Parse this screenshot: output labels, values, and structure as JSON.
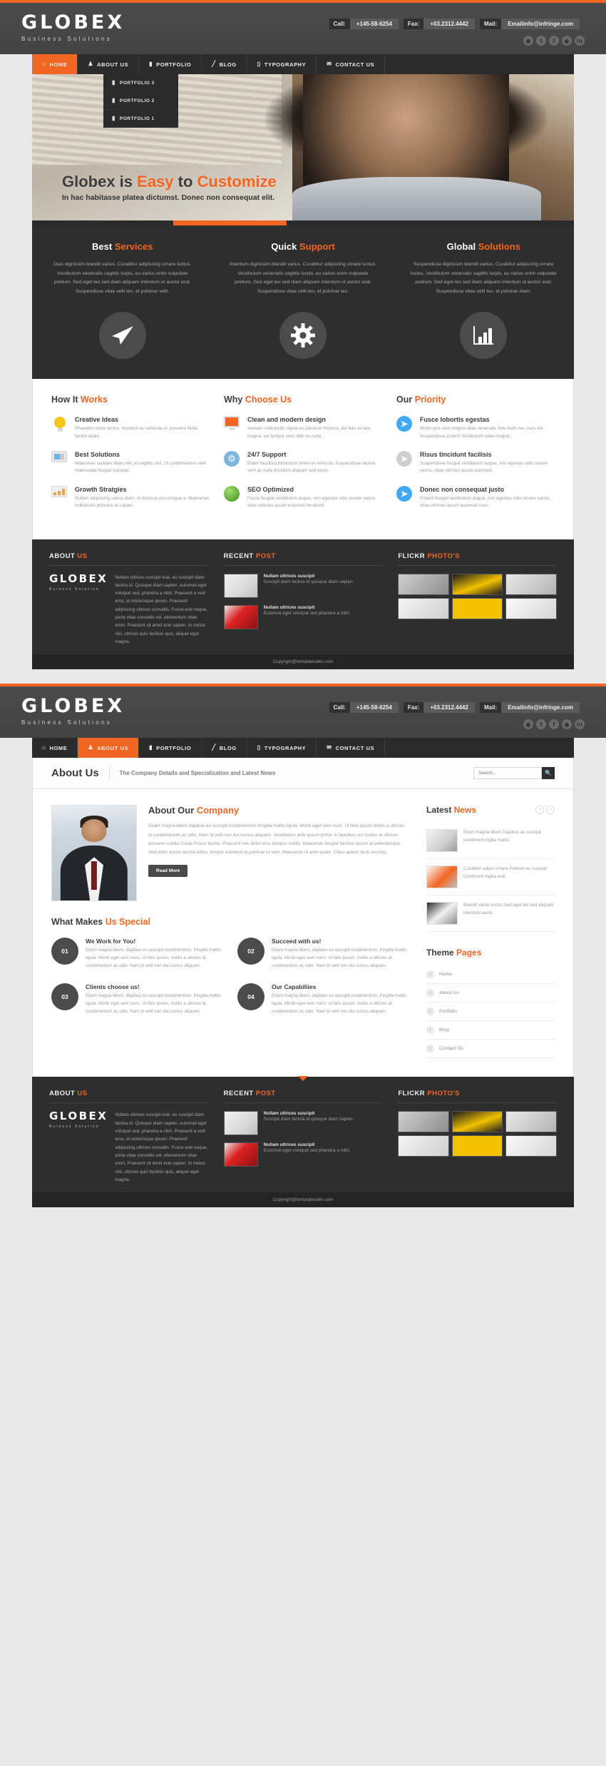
{
  "brand": {
    "name": "GLOBEX",
    "tagline": "Business Solutions",
    "accent": "#f26522",
    "dark": "#2e2e2e"
  },
  "contact": [
    {
      "label": "Call:",
      "value": "+145-58-6254"
    },
    {
      "label": "Fax:",
      "value": "+03.2312.4442"
    },
    {
      "label": "Mail:",
      "value": "Emailinfo@infringe.com"
    }
  ],
  "social": [
    {
      "name": "rss-icon",
      "glyph": "●"
    },
    {
      "name": "twitter-icon",
      "glyph": "t"
    },
    {
      "name": "facebook-icon",
      "glyph": "f"
    },
    {
      "name": "dribbble-icon",
      "glyph": "●"
    },
    {
      "name": "linkedin-icon",
      "glyph": "in"
    }
  ],
  "nav": {
    "items": [
      {
        "label": "HOME",
        "icon": "home-icon",
        "glyph": "⌂",
        "active_page1": true,
        "active_page2": false
      },
      {
        "label": "ABOUT US",
        "icon": "user-icon",
        "glyph": "♟",
        "active_page1": false,
        "active_page2": true
      },
      {
        "label": "PORTFOLIO",
        "icon": "briefcase-icon",
        "glyph": "▮",
        "active_page1": false,
        "active_page2": false
      },
      {
        "label": "BLOG",
        "icon": "pencil-icon",
        "glyph": "╱",
        "active_page1": false,
        "active_page2": false
      },
      {
        "label": "TYPOGRAPHY",
        "icon": "document-icon",
        "glyph": "▯",
        "active_page1": false,
        "active_page2": false
      },
      {
        "label": "CONTACT US",
        "icon": "envelope-icon",
        "glyph": "✉",
        "active_page1": false,
        "active_page2": false
      }
    ],
    "dropdown": [
      {
        "label": "PORTFOLIO 3",
        "icon": "briefcase-icon",
        "glyph": "▮"
      },
      {
        "label": "PORTFOLIO 2",
        "icon": "briefcase-icon",
        "glyph": "▮"
      },
      {
        "label": "PORTFOLIO 1",
        "icon": "briefcase-icon",
        "glyph": "▮"
      }
    ]
  },
  "slider": {
    "title_plain_1": "Globex is ",
    "title_accent_1": "Easy",
    "title_plain_2": " to ",
    "title_accent_2": "Customize",
    "subtitle": "In hac habitasse platea dictumst. Donec non consequat elit."
  },
  "services": [
    {
      "title_plain": "Best ",
      "title_accent": "Services",
      "text": "Duis dignissim blandit varius. Curabitur adipiscing ornare luctus. Vestibulum venenatis sagittis turpis, eu varius enim vulputate pretium. Sed eget leo sed diam aliquam interdum ut auctor erat. Suspendisse vitae velit leo, et pulvinar velit.",
      "icon": "paper-plane-icon"
    },
    {
      "title_plain": "Quick ",
      "title_accent": "Support",
      "text": "Interdum dignissim blandit varius. Curabitur adipiscing ornare luctus. Vestibulum venenatis sagittis turpis, eu varius enim vulputate pretium. Sed eget leo sed diam aliquam interdum ut auctor erat. Suspendisse vitae velit leo, et pulvinar leo.",
      "icon": "gear-icon"
    },
    {
      "title_plain": "Global ",
      "title_accent": "Solutions",
      "text": "Suspendisse dignissim blandit varius. Curabitur adipiscing ornare luctus. Vestibulum venenatis sagittis turpis, eu varius enim vulputate pretium. Sed eget leo sed diam aliquam interdum ut auctor erat. Suspendisse vitae velit leo, et pulvinar diam.",
      "icon": "bar-chart-icon"
    }
  ],
  "features": [
    {
      "title_plain": "How It ",
      "title_accent": "Works",
      "items": [
        {
          "icon": "lightbulb-icon",
          "title": "Creative Ideas",
          "text": "Phasellus tortor lectus, tincidunt eu vehicula ut, posuere Nulla facilisi etiam ."
        },
        {
          "icon": "document-icon",
          "title": "Best Solutions",
          "text": "Maecenas sodales libero elit, et sagittis orci. Ut condimentum velit malesuada feugiat volutpat."
        },
        {
          "icon": "bar-chart-icon",
          "title": "Growth Stratgies",
          "text": "Nullam adipiscing varius diam, ut rhoncus orci congue a. Maecenas sollicitudin posuere at sapien."
        }
      ]
    },
    {
      "title_plain": "Why ",
      "title_accent": "Choose Us",
      "items": [
        {
          "icon": "monitor-icon",
          "title": "Clean and modern design",
          "text": "Aenean sollicitudin, ligula eu placerat rhoncus, dui felis ornare magna, vel tempor sem nibh eu nulla."
        },
        {
          "icon": "gear-icon",
          "title": "24/7 Support",
          "text": "Etiam faucibus bibendum lorem et vehicula. Suspendisse lacinia sem ac nulla tincidunt aliquam sed turpis."
        },
        {
          "icon": "globe-icon",
          "title": "SEO Optimized",
          "text": "Fusce feugiat vestibulum augue, non egestas odio ornare varius. vitae ultricies ipsum euismod hendrerit."
        }
      ]
    },
    {
      "title_plain": "Our ",
      "title_accent": "Priority",
      "items": [
        {
          "icon": "arrow-circle-icon",
          "title": "Fusce lobortis egestas",
          "text": "Morbi quis sem magna vitae venenatis felis Nam nec risus dui. Suspendisse potenti Vestibulum vitae magna."
        },
        {
          "icon": "arrow-circle-icon",
          "title": "Risus tincidunt facilisis",
          "text": "Suspendisse feugiat vestibulum augue, non egestas odio ornare varius. vitae ultricies ipsum euismod."
        },
        {
          "icon": "arrow-circle-icon",
          "title": "Donec non consequat justo",
          "text": "Potenti feugiat vestibulum augue, non egestas odio ornare varius. vitae ultricies ipsum euismod risus."
        }
      ]
    }
  ],
  "footer": {
    "about": {
      "title_plain": "ABOUT ",
      "title_accent": "US",
      "logo_main": "GLOBEX",
      "logo_sub": "Buiness Solution",
      "text": "Nullam ultrices suscipit erat, eu suscipit diam lacinia id. Quisque diam sapien, euismod eget volutpat sed, pharetra a nibh. Praesent a velit eros, id scelerisque ipsum. Praesent adipiscing ultrices convallis. Fusce erat neque, porta vitae convallis vel, elementum vitae enim. Praesent sit amet erat sapien. In metus nisl, ultrices quis facilisis quis, aliquet eget magna."
    },
    "recent": {
      "title_plain": "RECENT ",
      "title_accent": "POST",
      "posts": [
        {
          "title": "Nullam ultrices suscipit",
          "text": "Suscipit diam lacinia id quisque diam sapien.",
          "thumb": "warranty-document-thumb"
        },
        {
          "title": "Nullam ultrices suscipit",
          "text": "Euismod eget volutpat sed pharetra a nibh.",
          "thumb": "red-card-thumb"
        }
      ]
    },
    "flickr": {
      "title_plain": "FLICKR ",
      "title_accent": "PHOTO'S",
      "count": 6
    },
    "copyright": "Copyright@templatesden.com"
  },
  "page2": {
    "page_title": "About Us",
    "page_subtitle": "The Company Details and Specialization and Latest News",
    "search": {
      "placeholder": "Search..",
      "value": "",
      "icon": "search-icon"
    },
    "about": {
      "title_plain": "About Our ",
      "title_accent": "Company",
      "text": "Etiam magna libero dapibus eu suscipit condimentum fringilla mattis ligula. Morbi eget sem nunc. Ut felis ipsum mollis a ultrices id condimentum ac odio. Nam id velit non dui cursus aliquam. Vestibulum ante ipsum primis in faucibus orci luctus et ultrices posuere cubilia Curae Fusce facilisi. Praesent nec dolor eros tempus mollis. Maecenas feugiat facilisis ipsum at pellentesque. Sed dolor ipsum lacinia tellus, tempor euismod at pulvinar ut sem. Maecenas id ante quam. Class aptent taciti sociosq.",
      "button": "Read More",
      "photo": "businessman-photo"
    },
    "special": {
      "title_plain": "What Makes ",
      "title_accent": "Us Special",
      "items": [
        {
          "num": "01",
          "title": "We Work for You!",
          "text": "Etiam magna libero, dapibus eu suscipit condimentum, fringilla mattis ligula. Morbi eget sem nunc. Ut felis ipsum, mollis a ultrices id, condimentum ac odio. Nam id velit non dui cursus aliquam."
        },
        {
          "num": "02",
          "title": "Succeed with us!",
          "text": "Etiam magna libero, dapibus eu suscipit condimentum, fringilla mattis ligula. Morbi eget sem nunc. Ut felis ipsum, mollis a ultrices id, condimentum ac odio. Nam id velit non dui cursus aliquam."
        },
        {
          "num": "03",
          "title": "Clients choose us!",
          "text": "Etiam magna libero, dapibus eu suscipit condimentum, fringilla mattis ligula. Morbi eget sem nunc. Ut felis ipsum, mollis a ultrices id, condimentum ac odio. Nam id velit non dui cursus aliquam."
        },
        {
          "num": "04",
          "title": "Our Capabiliies",
          "text": "Etiam magna libero, dapibus eu suscipit condimentum, fringilla mattis ligula. Morbi eget sem nunc. Ut felis ipsum, mollis a ultrices id, condimentum ac odio. Nam id velit non dui cursus aliquam."
        }
      ]
    },
    "latest_news": {
      "title_plain": "Latest ",
      "title_accent": "News",
      "prev": "‹",
      "next": "›",
      "items": [
        {
          "text": "Etiam magna libero Dapibus eu suscipit condiment ingilla mattis.",
          "thumb": "news-thumb-1"
        },
        {
          "text": "Curabitur adipis ornare Pretium eu suscipit condiment ingilla erat.",
          "thumb": "news-thumb-2"
        },
        {
          "text": "Blandit varius luctus Sed eget leo sed aliquam interdunt aucto",
          "thumb": "news-thumb-3"
        }
      ]
    },
    "theme_pages": {
      "title_plain": "Theme ",
      "title_accent": "Pages",
      "items": [
        "Home",
        "About Us",
        "Portfolio",
        "Blog",
        "Contact Us"
      ]
    }
  }
}
